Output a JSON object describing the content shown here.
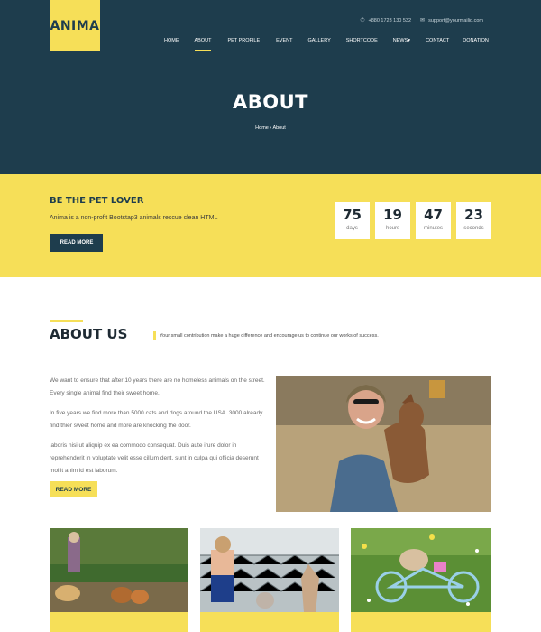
{
  "header": {
    "logo": "ANIMA",
    "phone_icon": "phone-icon",
    "phone": "+880 1723 130 532",
    "email_icon": "envelope-icon",
    "email": "support@yourmailid.com",
    "nav": [
      "HOME",
      "ABOUT",
      "PET PROFILE",
      "EVENT",
      "GALLERY",
      "SHORTCODE",
      "NEWS",
      "CONTACT",
      "DONATION"
    ],
    "nav_active": "ABOUT",
    "news_caret": "▾"
  },
  "hero": {
    "title": "ABOUT",
    "breadcrumb_home": "Home",
    "breadcrumb_sep": "›",
    "breadcrumb_current": "About"
  },
  "band": {
    "title": "BE THE PET LOVER",
    "text": "Anima is a non-profit Bootstap3 animals rescue clean HTML",
    "button": "READ MORE",
    "countdown": [
      {
        "value": "75",
        "label": "days"
      },
      {
        "value": "19",
        "label": "hours"
      },
      {
        "value": "47",
        "label": "minutes"
      },
      {
        "value": "23",
        "label": "seconds"
      }
    ]
  },
  "about": {
    "title": "ABOUT US",
    "note": "Your small contribution make a huge difference and encourage us to continue our works of success.",
    "paragraphs": [
      "We want to ensure that after 10 years there are no homeless animals on the street. Every single animal find their sweet home.",
      "In five years we find more than 5000 cats and dogs around the USA. 3000 already find thier sweet home and more are knocking the door.",
      "laboris nisi ut aliquip ex ea commodo consequat. Duis aute irure dolor in reprehenderit in voluptate velit esse cillum dent. sunt in culpa qui officia deserunt mollit anim id est laborum."
    ],
    "button": "READ MORE"
  },
  "colors": {
    "navy": "#1e3d4d",
    "yellow": "#f6df58"
  }
}
